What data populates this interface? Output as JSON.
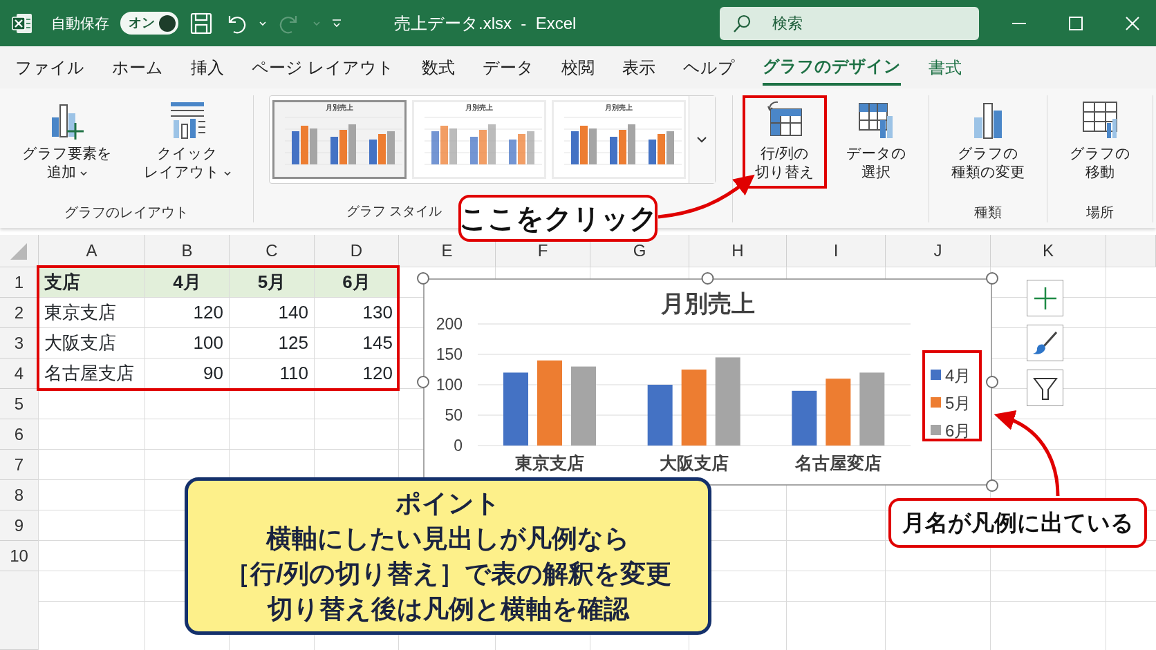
{
  "window": {
    "title": "売上データ.xlsx  -  Excel",
    "autosave_label": "自動保存",
    "autosave": {
      "label": "オン",
      "on": true
    },
    "redo_disabled": true,
    "search_placeholder": "検索"
  },
  "tabs": [
    {
      "label": "ファイル",
      "selected": false,
      "contextual": false
    },
    {
      "label": "ホーム",
      "selected": false,
      "contextual": false
    },
    {
      "label": "挿入",
      "selected": false,
      "contextual": false
    },
    {
      "label": "ページ レイアウト",
      "selected": false,
      "contextual": false
    },
    {
      "label": "数式",
      "selected": false,
      "contextual": false
    },
    {
      "label": "データ",
      "selected": false,
      "contextual": false
    },
    {
      "label": "校閲",
      "selected": false,
      "contextual": false
    },
    {
      "label": "表示",
      "selected": false,
      "contextual": false
    },
    {
      "label": "ヘルプ",
      "selected": false,
      "contextual": false
    },
    {
      "label": "グラフのデザイン",
      "selected": true,
      "contextual": true
    },
    {
      "label": "書式",
      "selected": false,
      "contextual": true
    }
  ],
  "ribbon_groups": [
    {
      "label": "グラフのレイアウト",
      "buttons": [
        {
          "kind": "add-element",
          "lines": [
            "グラフ要素を",
            "追加"
          ],
          "dropdown": true,
          "highlighted": false
        },
        {
          "kind": "quick-layout",
          "lines": [
            "クイック",
            "レイアウト"
          ],
          "dropdown": true,
          "highlighted": false
        }
      ]
    },
    {
      "label": "グラフ スタイル",
      "chart_styles": [
        {
          "title": "月別売上",
          "selected": true
        },
        {
          "title": "月別売上",
          "selected": false
        },
        {
          "title": "月別売上",
          "selected": false
        }
      ]
    },
    {
      "buttons": [
        {
          "kind": "switch",
          "lines": [
            "行/列の",
            "切り替え"
          ],
          "dropdown": false,
          "highlighted": true
        },
        {
          "kind": "select-data",
          "lines": [
            "データの",
            "選択"
          ],
          "dropdown": false,
          "highlighted": false
        }
      ]
    },
    {
      "label": "種類",
      "buttons": [
        {
          "kind": "change-type",
          "lines": [
            "グラフの",
            "種類の変更"
          ],
          "dropdown": false,
          "highlighted": false
        }
      ]
    },
    {
      "label": "場所",
      "buttons": [
        {
          "kind": "move",
          "lines": [
            "グラフの",
            "移動"
          ],
          "dropdown": false,
          "highlighted": false
        }
      ]
    }
  ],
  "sheet": {
    "columns": [
      "A",
      "B",
      "C",
      "D",
      "E",
      "F",
      "G",
      "H",
      "I",
      "J",
      "K"
    ],
    "row_numbers": [
      "1",
      "2",
      "3",
      "4",
      "5",
      "6",
      "7",
      "8",
      "9",
      "10"
    ],
    "table": {
      "highlighted": true,
      "header": [
        "支店",
        "4月",
        "5月",
        "6月"
      ],
      "rows": [
        [
          "東京支店",
          "120",
          "140",
          "130"
        ],
        [
          "大阪支店",
          "100",
          "125",
          "145"
        ],
        [
          "名古屋支店",
          "90",
          "110",
          "120"
        ]
      ]
    }
  },
  "chart": {
    "legend_highlighted": true,
    "chart_data": {
      "type": "bar",
      "title": "月別売上",
      "categories": [
        "東京支店",
        "大阪支店",
        "名古屋変店"
      ],
      "series": [
        {
          "name": "4月",
          "color": "#4472c4",
          "values": [
            120,
            100,
            90
          ]
        },
        {
          "name": "5月",
          "color": "#ed7d31",
          "values": [
            140,
            125,
            110
          ]
        },
        {
          "name": "6月",
          "color": "#a5a5a5",
          "values": [
            130,
            145,
            120
          ]
        }
      ],
      "ylim": [
        0,
        200
      ],
      "yticks": [
        0,
        50,
        100,
        150,
        200
      ],
      "grid": true,
      "legend": true
    }
  },
  "callouts": [
    {
      "text": "ここをクリック"
    },
    {
      "text": "月名が凡例に出ている"
    }
  ],
  "point": {
    "title": "ポイント",
    "lines": [
      "横軸にしたい見出しが凡例なら",
      "［行/列の切り替え］で表の解釈を変更",
      "切り替え後は凡例と横軸を確認"
    ]
  }
}
